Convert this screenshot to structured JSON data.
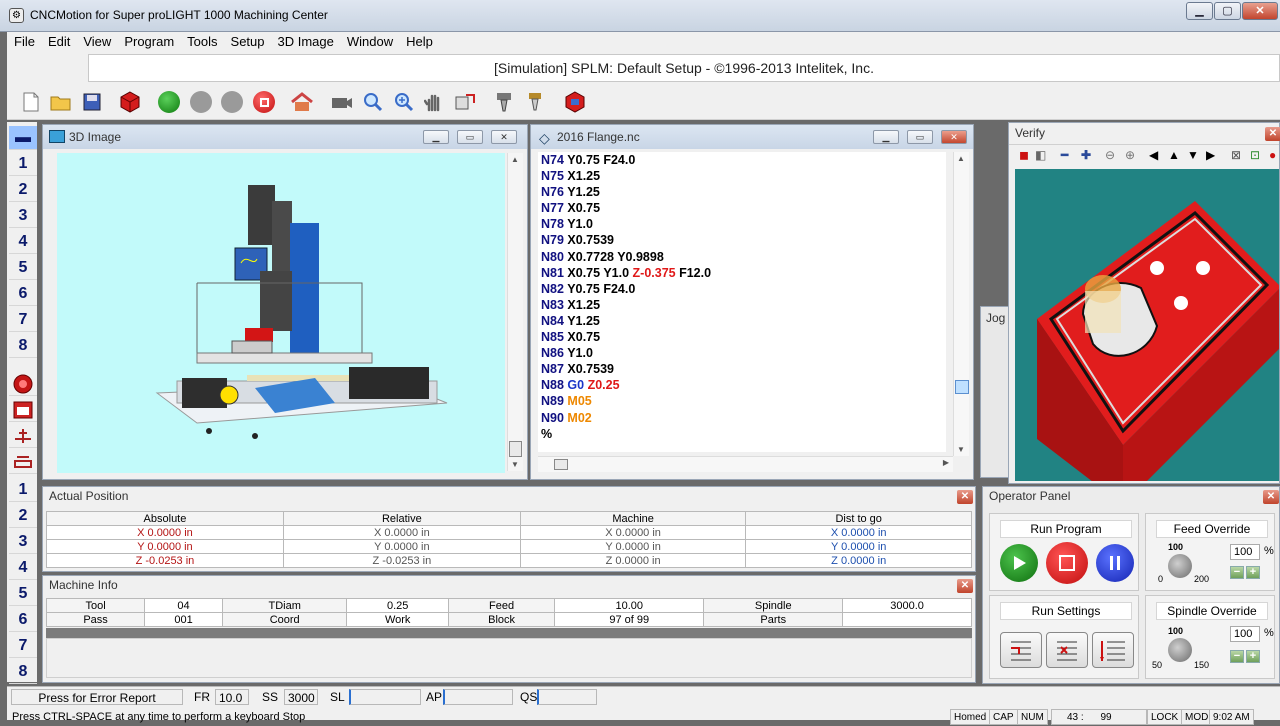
{
  "window": {
    "title": "CNCMotion for Super proLIGHT 1000 Machining Center",
    "minimize": "▁",
    "maximize": "▢",
    "close": "✕"
  },
  "menu": [
    "File",
    "Edit",
    "View",
    "Program",
    "Tools",
    "Setup",
    "3D Image",
    "Window",
    "Help"
  ],
  "status_line": "[Simulation] SPLM: Default Setup - ©1996-2013 Intelitek, Inc.",
  "left_strip": {
    "top_numbers": [
      "1",
      "2",
      "3",
      "4",
      "5",
      "6",
      "7",
      "8"
    ],
    "bottom_numbers": [
      "1",
      "2",
      "3",
      "4",
      "5",
      "6",
      "7",
      "8"
    ]
  },
  "image_panel": {
    "title": "3D Image"
  },
  "code_panel": {
    "title": "2016 Flange.nc",
    "lines": [
      [
        {
          "t": "N74 ",
          "c": "ln"
        },
        {
          "t": "Y0.75 F24.0",
          "c": "gx"
        }
      ],
      [
        {
          "t": "N75 ",
          "c": "ln"
        },
        {
          "t": "X1.25",
          "c": "gx"
        }
      ],
      [
        {
          "t": "N76 ",
          "c": "ln"
        },
        {
          "t": "Y1.25",
          "c": "gx"
        }
      ],
      [
        {
          "t": "N77 ",
          "c": "ln"
        },
        {
          "t": "X0.75",
          "c": "gx"
        }
      ],
      [
        {
          "t": "N78 ",
          "c": "ln"
        },
        {
          "t": "Y1.0",
          "c": "gx"
        }
      ],
      [
        {
          "t": "N79 ",
          "c": "ln"
        },
        {
          "t": "X0.7539",
          "c": "gx"
        }
      ],
      [
        {
          "t": "N80 ",
          "c": "ln"
        },
        {
          "t": "X0.7728 Y0.9898",
          "c": "gx"
        }
      ],
      [
        {
          "t": "N81 ",
          "c": "ln"
        },
        {
          "t": "X0.75 Y1.0 ",
          "c": "gx"
        },
        {
          "t": "Z-0.375",
          "c": "red"
        },
        {
          "t": " F12.0",
          "c": "gx"
        }
      ],
      [
        {
          "t": "N82 ",
          "c": "ln"
        },
        {
          "t": "Y0.75 F24.0",
          "c": "gx"
        }
      ],
      [
        {
          "t": "N83 ",
          "c": "ln"
        },
        {
          "t": "X1.25",
          "c": "gx"
        }
      ],
      [
        {
          "t": "N84 ",
          "c": "ln"
        },
        {
          "t": "Y1.25",
          "c": "gx"
        }
      ],
      [
        {
          "t": "N85 ",
          "c": "ln"
        },
        {
          "t": "X0.75",
          "c": "gx"
        }
      ],
      [
        {
          "t": "N86 ",
          "c": "ln"
        },
        {
          "t": "Y1.0",
          "c": "gx"
        }
      ],
      [
        {
          "t": "N87 ",
          "c": "ln"
        },
        {
          "t": "X0.7539",
          "c": "gx"
        }
      ],
      [
        {
          "t": "N88 ",
          "c": "ln"
        },
        {
          "t": "G0 ",
          "c": "blu"
        },
        {
          "t": "Z0.25",
          "c": "red"
        }
      ],
      [
        {
          "t": "N89 ",
          "c": "ln"
        },
        {
          "t": "M05",
          "c": "org"
        }
      ],
      [
        {
          "t": "N90 ",
          "c": "ln"
        },
        {
          "t": "M02",
          "c": "org"
        }
      ],
      [
        {
          "t": "%",
          "c": "gx"
        }
      ]
    ]
  },
  "verify_panel": {
    "title": "Verify"
  },
  "jog_label": "Jog",
  "actual_position": {
    "title": "Actual Position",
    "headers": [
      "Absolute",
      "Relative",
      "Machine",
      "Dist to go"
    ],
    "rows": [
      [
        "X  0.0000 in",
        "X  0.0000 in",
        "X  0.0000 in",
        "X  0.0000 in"
      ],
      [
        "Y  0.0000 in",
        "Y  0.0000 in",
        "Y  0.0000 in",
        "Y  0.0000 in"
      ],
      [
        "Z  -0.0253 in",
        "Z  -0.0253 in",
        "Z  0.0000 in",
        "Z  0.0000 in"
      ]
    ]
  },
  "machine_info": {
    "title": "Machine Info",
    "rows": [
      [
        "Tool",
        "04",
        "TDiam",
        "0.25",
        "Feed",
        "10.00",
        "Spindle",
        "3000.0"
      ],
      [
        "Pass",
        "001",
        "Coord",
        "Work",
        "Block",
        "97 of 99",
        "Parts",
        ""
      ]
    ]
  },
  "operator_panel": {
    "title": "Operator Panel",
    "run_program": "Run Program",
    "feed_override": "Feed Override",
    "feed_value": "100",
    "feed_knob_top": "100",
    "feed_knob_min": "0",
    "feed_knob_max": "200",
    "run_settings": "Run Settings",
    "spindle_override": "Spindle Override",
    "spindle_value": "100",
    "spindle_knob_top": "100",
    "spindle_knob_min": "50",
    "spindle_knob_max": "150",
    "percent": "%",
    "minus": "−",
    "plus": "+"
  },
  "status_bar": {
    "error_report": "Press for Error Report",
    "fr_label": "FR",
    "fr_value": "10.0",
    "ss_label": "SS",
    "ss_value": "3000",
    "sl_label": "SL",
    "ap_label": "AP",
    "qs_label": "QS",
    "hint": "Press CTRL-SPACE at any time to perform a keyboard Stop",
    "homed": "Homed",
    "cap": "CAP",
    "num": "NUM",
    "cursor_line": "43",
    "cursor_sep": ":",
    "cursor_total": "99",
    "lock": "LOCK",
    "mod": "MOD",
    "time": "9:02 AM"
  },
  "colors": {
    "viewport_bg": "#c2fafa",
    "verify_bg": "#218383",
    "workpiece": "#e11d1d"
  }
}
